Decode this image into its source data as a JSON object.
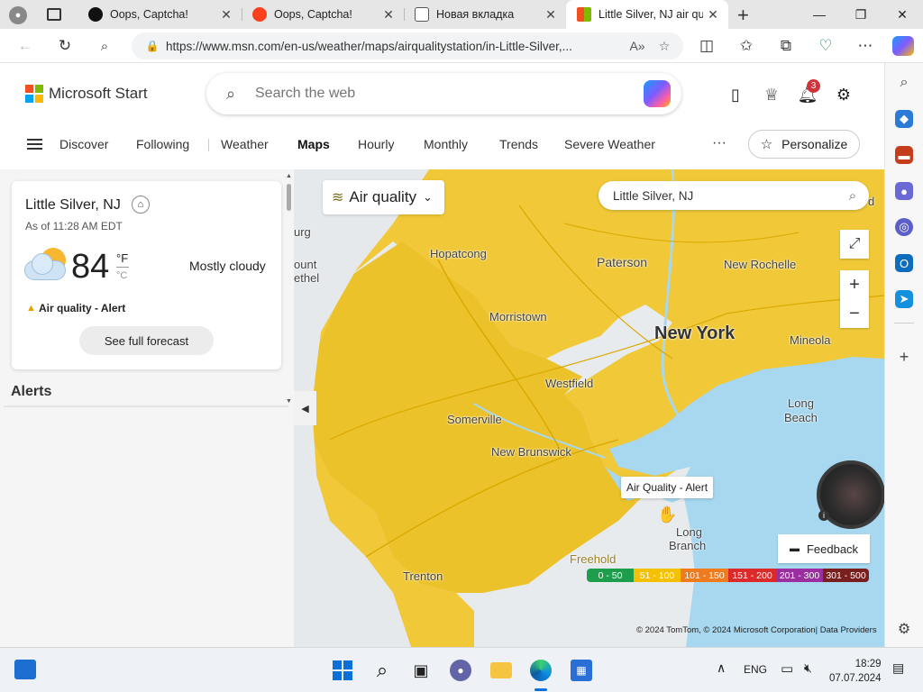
{
  "browser": {
    "tabs": [
      {
        "title": "Oops, Captcha!",
        "icon": "captcha-icon",
        "color": "#111111"
      },
      {
        "title": "Oops, Captcha!",
        "icon": "yandex-icon",
        "color": "#fc3f1d"
      },
      {
        "title": "Новая вкладка",
        "icon": "new-tab-icon",
        "color": "#555555"
      },
      {
        "title": "Little Silver, NJ air qua",
        "icon": "msn-icon",
        "color": "#0078d4",
        "active": true
      }
    ],
    "new_tab_symbol": "+",
    "close_symbol": "✕",
    "url": "https://www.msn.com/en-us/weather/maps/airqualitystation/in-Little-Silver,..."
  },
  "header": {
    "brand": "Microsoft Start",
    "search_placeholder": "Search the web",
    "notification_count": "3"
  },
  "nav": {
    "items": [
      "Discover",
      "Following",
      "Weather",
      "Maps",
      "Hourly",
      "Monthly",
      "Trends",
      "Severe Weather"
    ],
    "active": "Maps",
    "more": "···",
    "personalize": "Personalize"
  },
  "weather_card": {
    "location": "Little Silver, NJ",
    "as_of": "As of 11:28 AM EDT",
    "temperature": "84",
    "unit_f": "°F",
    "unit_c": "°C",
    "condition": "Mostly cloudy",
    "alert": "Air quality - Alert",
    "forecast_button": "See full forecast"
  },
  "alerts_title": "Alerts",
  "map": {
    "layer_button": "Air quality",
    "search_value": "Little Silver, NJ",
    "tooltip": "Air Quality - Alert",
    "feedback": "Feedback",
    "copyright": "© 2024 TomTom, © 2024 Microsoft Corporation| Data Providers",
    "labels": {
      "hopatcong": "Hopatcong",
      "paterson": "Paterson",
      "new_rochelle": "New Rochelle",
      "morristown": "Morristown",
      "new_york": "New York",
      "mineola": "Mineola",
      "westfield": "Westfield",
      "somerville": "Somerville",
      "long_beach_1": "Long",
      "long_beach_2": "Beach",
      "new_brunswick": "New Brunswick",
      "long_branch_1": "Long",
      "long_branch_2": "Branch",
      "freehold": "Freehold",
      "trenton": "Trenton",
      "burg": "urg",
      "mount": "ount",
      "bethel": "ethel",
      "d_edge": "d"
    },
    "legend": [
      {
        "range": "0 - 50",
        "color": "#1e9e4c"
      },
      {
        "range": "51 - 100",
        "color": "#f5c000"
      },
      {
        "range": "101 - 150",
        "color": "#f07a1c"
      },
      {
        "range": "151 - 200",
        "color": "#dc2a2a"
      },
      {
        "range": "201 - 300",
        "color": "#9c2fa0"
      },
      {
        "range": "301 - 500",
        "color": "#7a1f1f"
      }
    ],
    "aq_fill": "#f0c62d"
  },
  "taskbar": {
    "language": "ENG",
    "time": "18:29",
    "date": "07.07.2024"
  }
}
